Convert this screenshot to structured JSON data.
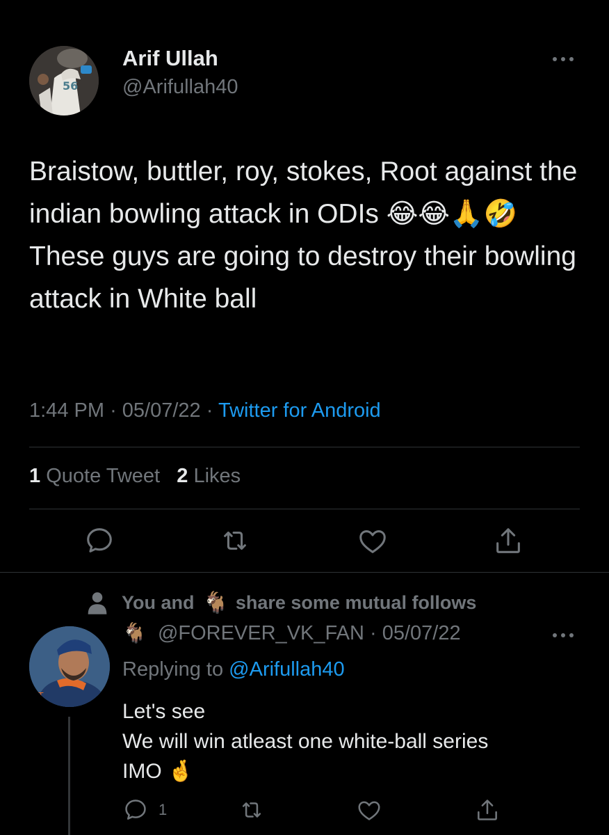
{
  "tweet": {
    "author_name": "Arif Ullah",
    "author_handle": "@Arifullah40",
    "text": "Braistow, buttler, roy, stokes, Root against the indian bowling attack in ODIs 😂😂🙏🤣 These guys are going to destroy their bowling attack in White ball",
    "time": "1:44 PM",
    "date": "05/07/22",
    "separator": "·",
    "source": "Twitter for Android",
    "quote_tweet_count": "1",
    "quote_tweet_label": "Quote Tweet",
    "likes_count": "2",
    "likes_label": "Likes",
    "actions": [
      {
        "icon": "reply-icon"
      },
      {
        "icon": "retweet-icon"
      },
      {
        "icon": "like-icon"
      },
      {
        "icon": "share-icon"
      }
    ]
  },
  "reply": {
    "mutual_prefix": "You and",
    "mutual_emoji": "🐐",
    "mutual_suffix": "share some mutual follows",
    "name_emoji": "🐐",
    "handle": "@FOREVER_VK_FAN",
    "date": "05/07/22",
    "separator": "·",
    "replying_label": "Replying to",
    "replying_to": "@Arifullah40",
    "text": "Let's see\nWe will win atleast one white-ball series\nIMO 🤞",
    "reply_count": "1",
    "actions": [
      {
        "icon": "reply-icon"
      },
      {
        "icon": "retweet-icon"
      },
      {
        "icon": "like-icon"
      },
      {
        "icon": "share-icon"
      }
    ]
  },
  "colors": {
    "background": "#000000",
    "text": "#e7e9ea",
    "secondary_text": "#71767b",
    "link": "#1d9bf0",
    "divider": "#2f3336"
  }
}
